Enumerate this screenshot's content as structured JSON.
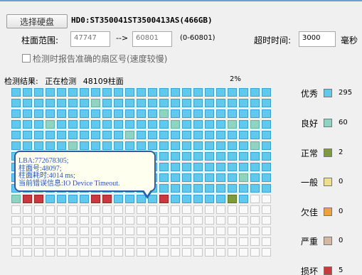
{
  "toolbar": {
    "select_disk_label": "选择硬盘",
    "disk_label": "HD0:ST350041ST3500413AS(466GB)"
  },
  "range": {
    "label": "柱面范围:",
    "start_value": "47747",
    "arrow": "-->",
    "end_value": "60801",
    "range_text": "(0-60801)"
  },
  "timeout": {
    "label": "超时时间:",
    "value": "3000",
    "unit": "毫秒"
  },
  "checkbox": {
    "label": "检测时报告准确的扇区号(速度较慢)",
    "checked": false
  },
  "status": {
    "result_label": "检测结果:",
    "state": "正在检测",
    "cylinder": "48109柱面",
    "progress": "2%"
  },
  "tooltip": {
    "lines": [
      "LBA:772678305;",
      "柱面号:48097;",
      "柱面耗时:4014 ms;",
      "当前错误信息:IO Device Timeout."
    ]
  },
  "legend": [
    {
      "label": "优秀",
      "count": "295",
      "color": "#62c9ee"
    },
    {
      "label": "良好",
      "count": "60",
      "color": "#8fd4c3"
    },
    {
      "label": "正常",
      "count": "2",
      "color": "#7d9b3a"
    },
    {
      "label": "一般",
      "count": "0",
      "color": "#eee08a"
    },
    {
      "label": "欠佳",
      "count": "0",
      "color": "#f0a13a"
    },
    {
      "label": "严重",
      "count": "0",
      "color": "#d6b7a1"
    },
    {
      "label": "损坏",
      "count": "5",
      "color": "#c83a3e"
    }
  ],
  "grid_rows": [
    "11111111111111111111111",
    "11111112111111111111111",
    "11111111111112111111111",
    "11121111111111211112121",
    "11111111112111111111111",
    "11111211111111111111121",
    "11111111111111111111111",
    "11111111111111111111111",
    "11111111111111111111211",
    "11211111111111111111111",
    "27711117711117111113100",
    "00000000000000000000000",
    "00000000000000000000000",
    "00000000000000000000000",
    "00000000000000000000000",
    "00000000000000000000000"
  ]
}
